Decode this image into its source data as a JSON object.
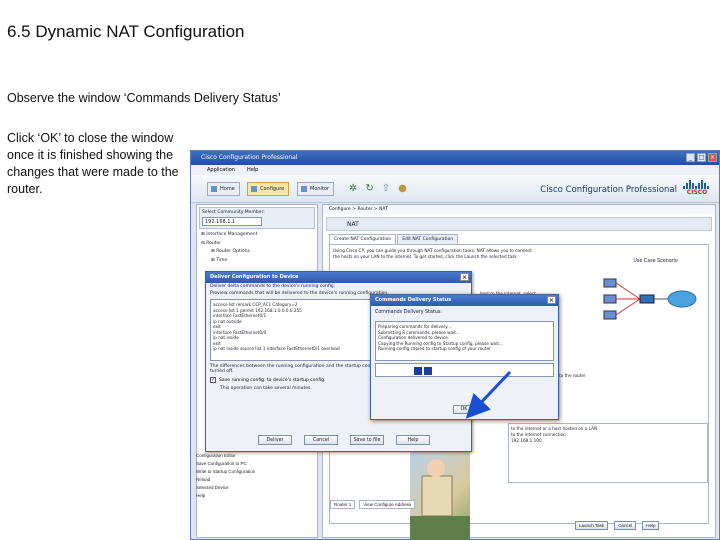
{
  "slide": {
    "title": "6.5 Dynamic NAT Configuration",
    "instruction1": "Observe  the window ‘Commands Delivery Status’",
    "instruction2": "Click ‘OK’ to close the window once it is finished showing the changes that were made to the router."
  },
  "app": {
    "window_title": "Cisco Configuration Professional",
    "menu": [
      "Application",
      "Help"
    ],
    "toolbar": {
      "home": "Home",
      "configure": "Configure",
      "monitor": "Monitor"
    },
    "brand": "Cisco Configuration Professional",
    "logo_word": "CISCO",
    "address_label": "Select Community Member:",
    "address_value": "192.168.1.1",
    "breadcrumb": "Configure > Router > NAT",
    "tree": [
      "Interface Management",
      "Router",
      "Router Options",
      "Time"
    ],
    "tree_lower": [
      "Configuration Editor",
      "Save Configuration to PC",
      "Write to Startup Configuration",
      "Reload",
      "Selected Device",
      "Help"
    ]
  },
  "nat": {
    "header": "NAT",
    "tabs": [
      "Create NAT Configuration",
      "Edit NAT Configuration"
    ],
    "description": "Using Cisco CP, you can guide you through NAT configuration tasks. NAT allows you to connect the hosts on your LAN to the internet. To get started, click the Launch the selected task",
    "use_case": "Use Case Scenario",
    "option_line": "host to the internet, select",
    "lower_text": "configuration to the router",
    "list_lines": [
      "to the internet or a host hosted on a LAN",
      "to the internet connection",
      "192.168.1.100"
    ]
  },
  "dialog_delivery": {
    "title": "Deliver Configuration to Device",
    "line1": "Deliver delta commands to the device's running config.",
    "line2": "Preview commands that will be delivered to the device's running configuration.",
    "commands": [
      "access-list remark CCP_ACL Category=2",
      "access-list 1 permit 192.168.1.0 0.0.0.255",
      "interface FastEthernet0/1",
      " ip nat outside",
      "exit",
      "interface FastEthernet0/0",
      " ip nat inside",
      "exit",
      "ip nat inside source list 1 interface FastEthernet0/1 overload"
    ],
    "note": "The differences between the running configuration and the startup configuration are lost whenever the device is turned off.",
    "checkbox_label": "Save running config. to device's startup config.",
    "checkbox_note": "This operation can take several minutes.",
    "buttons": [
      "Deliver",
      "Cancel",
      "Save to file",
      "Help"
    ]
  },
  "dialog_status": {
    "title": "Commands Delivery Status",
    "label": "Commands Delivery Status:",
    "log": [
      "Preparing commands for delivery...",
      "Submitting 8 commands, please wait...",
      "Configuration delivered to device.",
      "Copying the Running config to Startup config, please wait...",
      "Running config copied to startup config of your router"
    ],
    "ok": "OK"
  },
  "bottom": {
    "tabs": [
      "Router 1",
      "View Configure Address"
    ],
    "buttons": [
      "Launch Task",
      "Cancel",
      "Help"
    ]
  }
}
